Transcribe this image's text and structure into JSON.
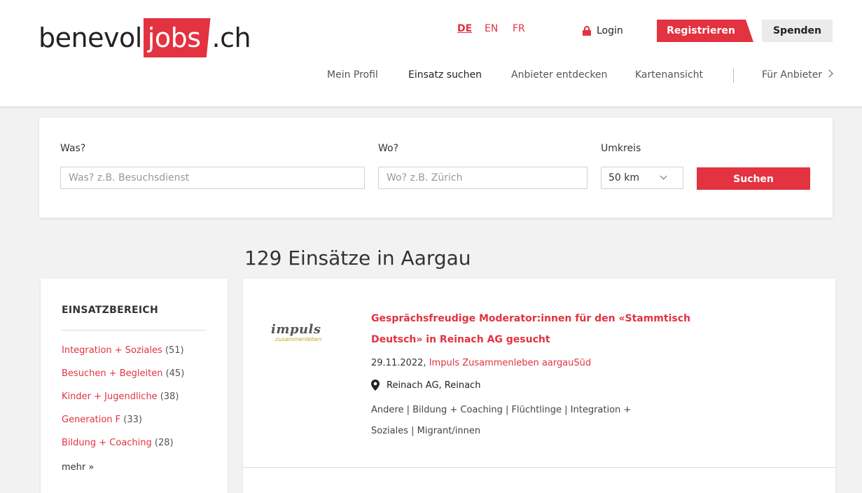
{
  "header": {
    "logo": {
      "part1": "benevol",
      "part2": "jobs",
      "part3": ".ch"
    },
    "languages": [
      "DE",
      "EN",
      "FR"
    ],
    "login_label": "Login",
    "register_label": "Registrieren",
    "donate_label": "Spenden",
    "nav": [
      "Mein Profil",
      "Einsatz suchen",
      "Anbieter entdecken",
      "Kartenansicht",
      "Für Anbieter"
    ]
  },
  "search": {
    "what_label": "Was?",
    "what_placeholder": "Was? z.B. Besuchsdienst",
    "where_label": "Wo?",
    "where_placeholder": "Wo? z.B. Zürich",
    "radius_label": "Umkreis",
    "radius_value": "50 km",
    "submit_label": "Suchen"
  },
  "results": {
    "title": "129 Einsätze in Aargau"
  },
  "sidebar": {
    "title": "EINSATZBEREICH",
    "items": [
      {
        "label": "Integration + Soziales",
        "count": "(51)"
      },
      {
        "label": "Besuchen + Begleiten",
        "count": "(45)"
      },
      {
        "label": "Kinder + Jugendliche",
        "count": "(38)"
      },
      {
        "label": "Generation F",
        "count": "(33)"
      },
      {
        "label": "Bildung + Coaching",
        "count": "(28)"
      }
    ],
    "more_label": "mehr »"
  },
  "cards": [
    {
      "logo_line1": "impuls",
      "logo_line2": "zusammenleben",
      "title": "Gesprächsfreudige Moderator:innen für den «Stammtisch Deutsch» in Reinach AG gesucht",
      "date": "29.11.2022,",
      "organization": "Impuls Zusammenleben aargauSüd",
      "location": "Reinach AG, Reinach",
      "tags": "Andere | Bildung + Coaching | Flüchtlinge | Integration + Soziales | Migrant/innen"
    }
  ]
}
